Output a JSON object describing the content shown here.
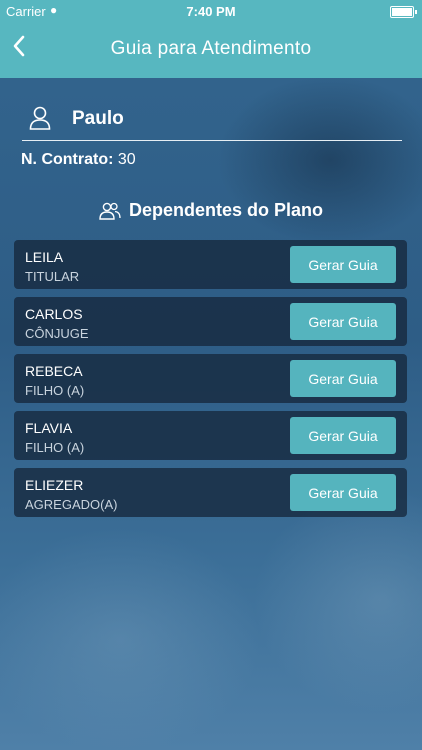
{
  "status": {
    "carrier": "Carrier",
    "time": "7:40 PM"
  },
  "nav": {
    "title": "Guia para Atendimento",
    "back_icon": "chevron-left-icon"
  },
  "user": {
    "name": "Paulo"
  },
  "contract": {
    "label": "N. Contrato:",
    "value": "30"
  },
  "section": {
    "title": "Dependentes do Plano"
  },
  "dependents": [
    {
      "name": "LEILA",
      "relation": "TITULAR",
      "button": "Gerar Guia"
    },
    {
      "name": "CARLOS",
      "relation": "CÔNJUGE",
      "button": "Gerar Guia"
    },
    {
      "name": "REBECA",
      "relation": "FILHO (A)",
      "button": "Gerar Guia"
    },
    {
      "name": "FLAVIA",
      "relation": "FILHO (A)",
      "button": "Gerar Guia"
    },
    {
      "name": "ELIEZER",
      "relation": "AGREGADO(A)",
      "button": "Gerar Guia"
    }
  ],
  "colors": {
    "accent": "#57b7c0",
    "button": "#55b4be"
  }
}
